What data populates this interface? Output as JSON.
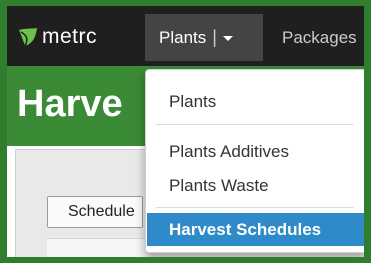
{
  "brand": {
    "name": "metrc",
    "accent_green": "#3a8a36",
    "frame_green": "#2f7d2d",
    "leaf_icon": "leaf-icon"
  },
  "navbar": {
    "plants_label": "Plants",
    "separator": "|",
    "packages_label": "Packages",
    "caret_icon": "caret-down-icon"
  },
  "page": {
    "title": "Harve"
  },
  "content": {
    "schedule_button_label": "Schedule"
  },
  "dropdown": {
    "items": [
      {
        "label": "Plants"
      },
      {
        "label": "Plants Additives"
      },
      {
        "label": "Plants Waste"
      },
      {
        "label": "Harvest Schedules",
        "selected": true
      }
    ],
    "highlight_color": "#2f8ac9"
  }
}
